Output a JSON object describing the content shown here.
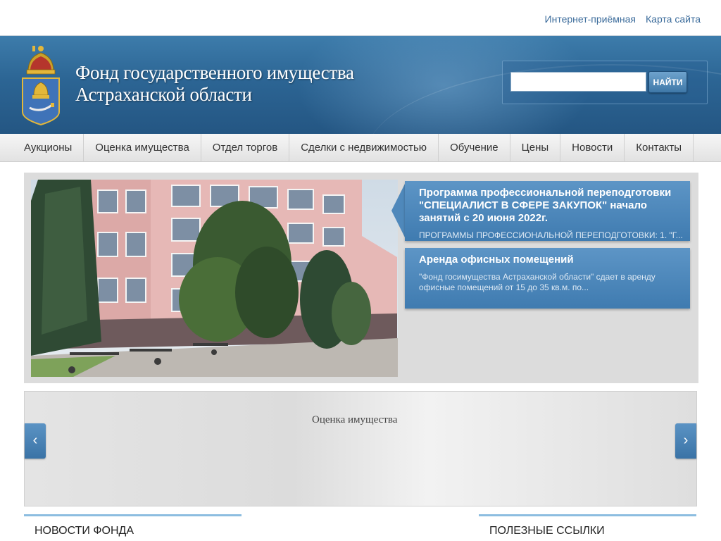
{
  "top_links": {
    "reception": "Интернет-приёмная",
    "sitemap": "Карта сайта"
  },
  "header": {
    "title_line1": "Фонд государственного имущества",
    "title_line2": "Астраханской области",
    "search_placeholder": "",
    "search_button": "НАЙТИ"
  },
  "nav": {
    "items": [
      {
        "label": "Аукционы"
      },
      {
        "label": "Оценка имущества"
      },
      {
        "label": "Отдел торгов"
      },
      {
        "label": "Сделки с недвижимостью"
      },
      {
        "label": "Обучение"
      },
      {
        "label": "Цены"
      },
      {
        "label": "Новости"
      },
      {
        "label": "Контакты"
      }
    ]
  },
  "featured": {
    "cards": [
      {
        "title": "Программа профессиональной переподготовки \"СПЕЦИАЛИСТ В СФЕРЕ ЗАКУПОК\" начало занятий с 20 июня 2022г.",
        "desc": "ПРОГРАММЫ ПРОФЕССИОНАЛЬНОЙ ПЕРЕПОДГОТОВКИ: 1. \"Г..."
      },
      {
        "title": "Аренда офисных помещений",
        "desc": "\"Фонд госимущества Астраханской области\" сдает в аренду офисные помещений от 15 до 35 кв.м. по..."
      }
    ]
  },
  "carousel": {
    "label": "Оценка имущества",
    "prev": "‹",
    "next": "›"
  },
  "sections": {
    "news": "НОВОСТИ ФОНДА",
    "links": "ПОЛЕЗНЫЕ ССЫЛКИ"
  },
  "colors": {
    "header_blue": "#2c6594",
    "accent_blue": "#4f88bb",
    "link_blue": "#3d6d9c"
  }
}
